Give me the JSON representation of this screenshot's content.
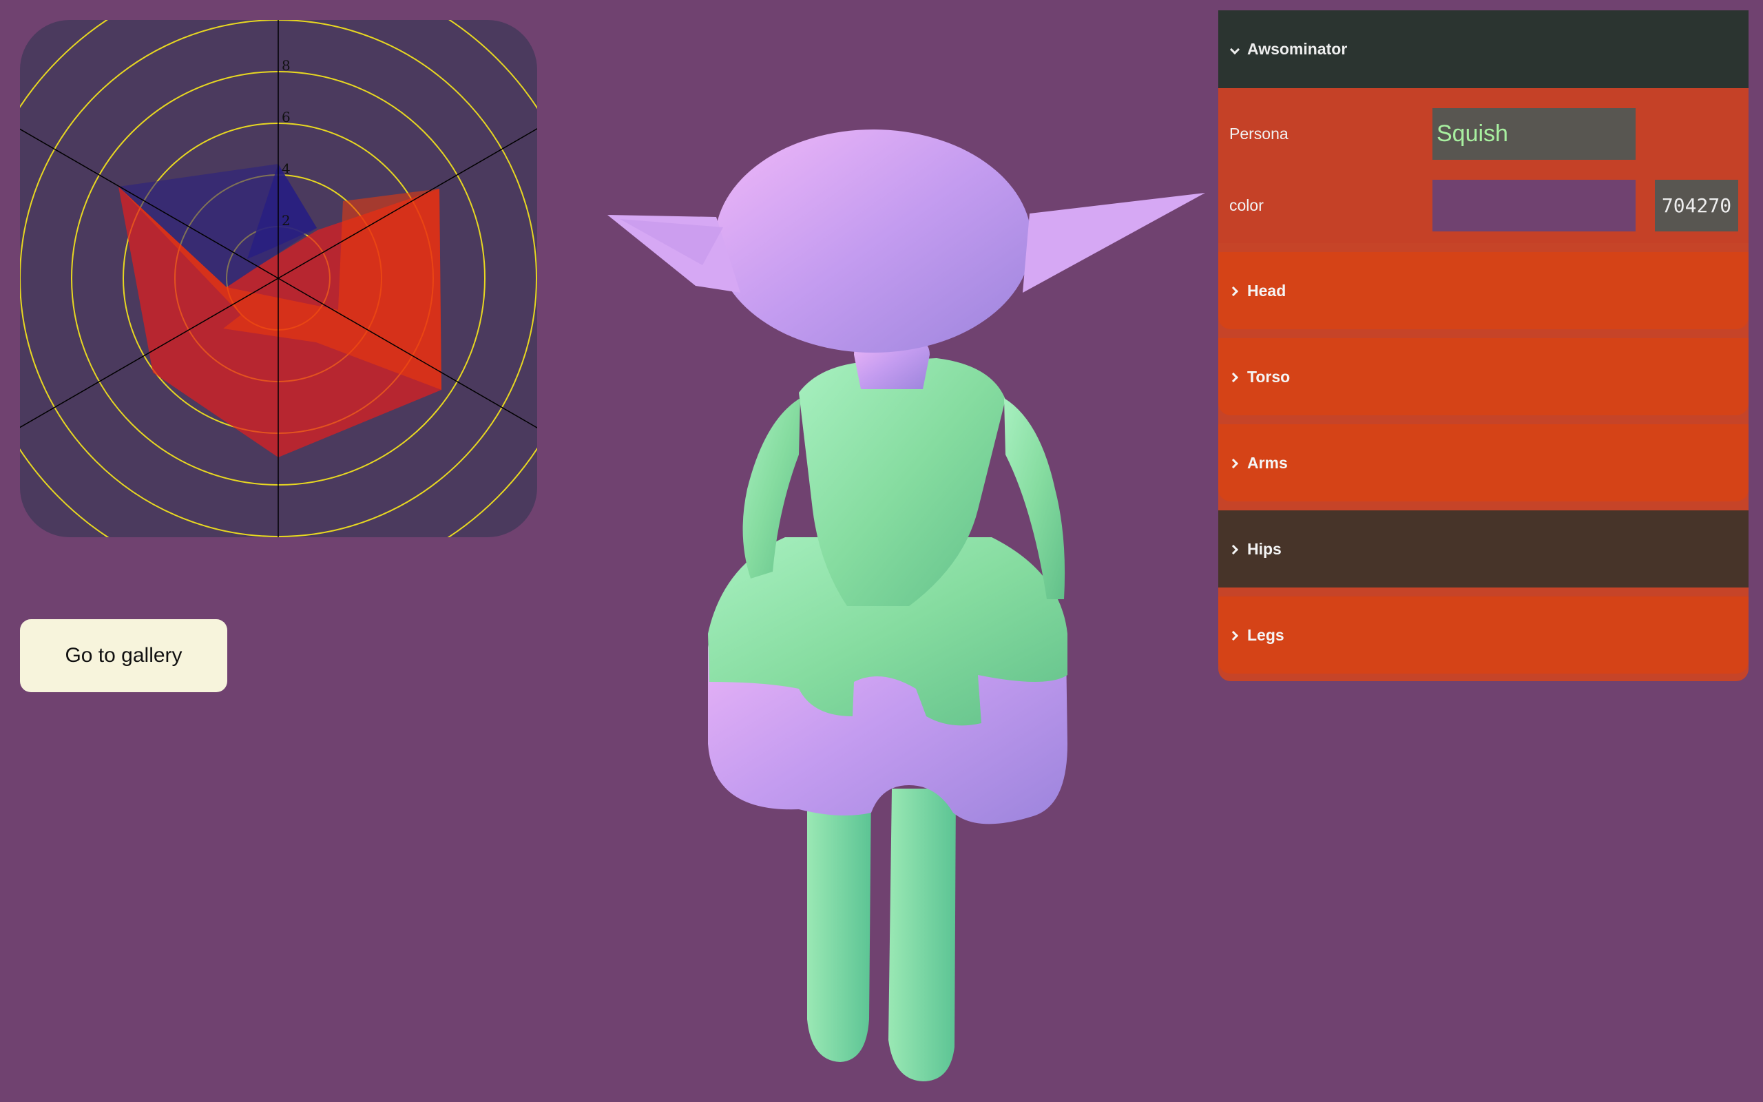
{
  "radar": {
    "ticks": [
      "2",
      "4",
      "6",
      "8"
    ],
    "colors": {
      "background": "#4b3a5e",
      "rings": "#e8d821",
      "spokes": "#000000",
      "series_blue": "#241f80",
      "series_red": "#e01e1e",
      "series_orange": "#f03a0a"
    }
  },
  "gallery_button": {
    "label": "Go to gallery"
  },
  "gui": {
    "title": "Awsominator",
    "persona": {
      "label": "Persona",
      "value": "Squish"
    },
    "color": {
      "label": "color",
      "value": "704270",
      "swatch": "#704270"
    },
    "folders": [
      {
        "label": "Head"
      },
      {
        "label": "Torso"
      },
      {
        "label": "Arms"
      },
      {
        "label": "Hips"
      },
      {
        "label": "Legs"
      }
    ],
    "colors": {
      "title_bg": "#2b3430",
      "panel_bg": "#c54127",
      "folder_bg": "#d54317",
      "folder_hover_bg": "#473429",
      "input_bg": "#585651",
      "input_text": "#a8f0a0"
    }
  },
  "model": {
    "colors": {
      "skin": "#c99aea",
      "cloth": "#8ee0a6"
    }
  }
}
